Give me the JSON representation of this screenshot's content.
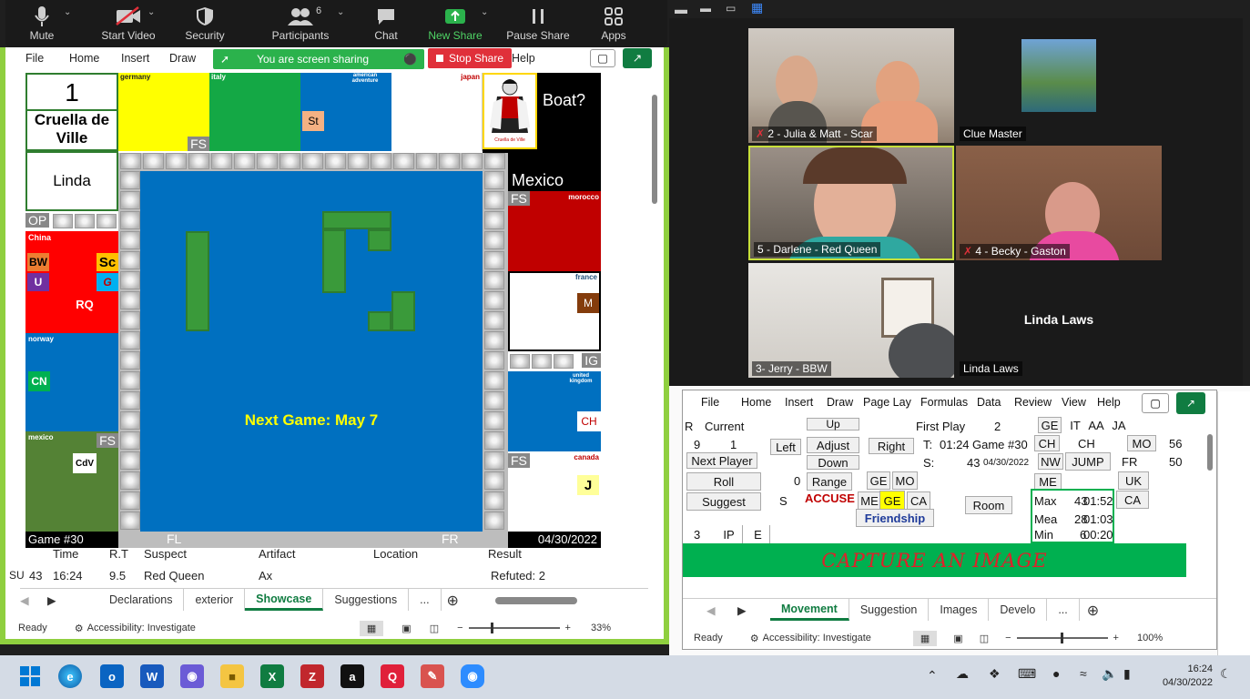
{
  "zoom_toolbar": {
    "mute": "Mute",
    "start_video": "Start Video",
    "security": "Security",
    "participants": "Participants",
    "participants_count": "6",
    "chat": "Chat",
    "new_share": "New Share",
    "pause_share": "Pause Share",
    "apps": "Apps"
  },
  "left_excel": {
    "menu": [
      "File",
      "Home",
      "Insert",
      "Draw"
    ],
    "menu_help": "Help",
    "sharing_status": "You are screen sharing",
    "stop_share": "Stop Share",
    "board": {
      "turn_number": "1",
      "character": "Cruella de Ville",
      "player": "Linda",
      "boat_label": "Boat?",
      "mexico_label": "Mexico",
      "cruella_caption": "Cruella de Ville",
      "center_message": "Next Game: May 7",
      "game_label": "Game #30",
      "date_label": "04/30/2022",
      "countries": {
        "germany": "germany",
        "italy": "italy",
        "american": "american adventure",
        "japan": "japan",
        "morocco": "morocco",
        "france": "france",
        "uk": "united kingdom",
        "canada": "canada",
        "china": "China",
        "norway": "norway",
        "mexico": "mexico"
      },
      "chips": {
        "fs1": "FS",
        "st": "St",
        "op": "OP",
        "bw": "BW",
        "sc": "Sc",
        "u": "U",
        "g": "G",
        "rq": "RQ",
        "cn": "CN",
        "fs2": "FS",
        "cdv": "CdV",
        "fs3": "FS",
        "m": "M",
        "ig": "IG",
        "ch": "CH",
        "fs4": "FS",
        "j": "J",
        "fl": "FL",
        "fr": "FR"
      }
    },
    "table": {
      "headers": [
        "Time",
        "R.T",
        "Suspect",
        "Artifact",
        "Location",
        "Result"
      ],
      "row_prefix": "SU",
      "row": [
        "43",
        "16:24",
        "9.5",
        "Red Queen",
        "Ax",
        "",
        "Refuted: 2"
      ]
    },
    "sheet_tabs": [
      "Declarations",
      "exterior",
      "Showcase",
      "Suggestions"
    ],
    "tabs_more": "...",
    "status_ready": "Ready",
    "accessibility": "Accessibility: Investigate",
    "zoom": "33%"
  },
  "video": {
    "tiles": [
      {
        "name": "2 - Julia & Matt - Scar"
      },
      {
        "name": "Clue Master"
      },
      {
        "name": "5 - Darlene - Red Queen"
      },
      {
        "name": "4 - Becky - Gaston"
      },
      {
        "name": "3- Jerry - BBW"
      },
      {
        "name": "Linda Laws"
      }
    ],
    "center_name": "Linda Laws"
  },
  "right_excel": {
    "menu": [
      "File",
      "Home",
      "Insert",
      "Draw",
      "Page Lay",
      "Formulas",
      "Data",
      "Review",
      "View",
      "Help"
    ],
    "r_label": "R",
    "current_label": "Current",
    "num9": "9",
    "num1": "1",
    "up": "Up",
    "left": "Left",
    "adjust": "Adjust",
    "right": "Right",
    "down": "Down",
    "range": "Range",
    "next_player": "Next Player",
    "roll": "Roll",
    "suggest": "Suggest",
    "zero": "0",
    "s_label": "S",
    "accuse": "ACCUSE",
    "first_play": "First Play",
    "first_play_val": "2",
    "t_label": "T:",
    "t_val": "01:24",
    "game_no": "Game #30",
    "s_colon": "S:",
    "s_val": "43",
    "date": "04/30/2022",
    "ge": "GE",
    "it": "IT",
    "aa": "AA",
    "ja": "JA",
    "ch1": "CH",
    "ch2": "CH",
    "mo": "MO",
    "num56": "56",
    "nw": "NW",
    "jump": "JUMP",
    "fr": "FR",
    "num50": "50",
    "me": "ME",
    "uk": "UK",
    "ge2": "GE",
    "mo2": "MO",
    "me2": "ME",
    "ge3": "GE",
    "ca": "CA",
    "ca2": "CA",
    "friendship": "Friendship",
    "room": "Room",
    "stats": [
      {
        "label": "Max",
        "n": "43",
        "t": "01:52"
      },
      {
        "label": "Mea",
        "n": "28",
        "t": "01:03"
      },
      {
        "label": "Min",
        "n": "6",
        "t": "00:20"
      }
    ],
    "three": "3",
    "ip": "IP",
    "e": "E",
    "capture": "CAPTURE AN IMAGE",
    "sheet_tabs": [
      "Movement",
      "Suggestion",
      "Images",
      "Develo"
    ],
    "tabs_more": "...",
    "status_ready": "Ready",
    "accessibility": "Accessibility: Investigate",
    "zoom": "100%"
  },
  "taskbar": {
    "time": "16:24",
    "date": "04/30/2022"
  }
}
